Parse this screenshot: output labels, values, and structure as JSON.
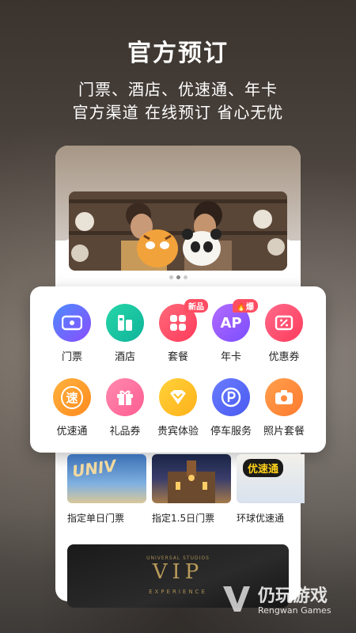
{
  "header": {
    "title": "官方预订",
    "subtitle_line1": "门票、酒店、优速通、年卡",
    "subtitle_line2": "官方渠道 在线预订 省心无忧"
  },
  "menu": {
    "items": [
      {
        "label": "门票",
        "icon": "ticket-icon",
        "color": "#5b6cf0"
      },
      {
        "label": "酒店",
        "icon": "hotel-icon",
        "color": "#19c6a3"
      },
      {
        "label": "套餐",
        "icon": "package-icon",
        "color": "#ff4d6a",
        "badge": "新品"
      },
      {
        "label": "年卡",
        "icon": "annual-pass-icon",
        "color": "#9b5cf6",
        "badge": "爆"
      },
      {
        "label": "优惠券",
        "icon": "coupon-icon",
        "color": "#ff4d6a"
      },
      {
        "label": "优速通",
        "icon": "express-icon",
        "color": "#ff9a2e"
      },
      {
        "label": "礼品券",
        "icon": "gift-icon",
        "color": "#ff6fa0"
      },
      {
        "label": "贵宾体验",
        "icon": "vip-icon",
        "color": "#ffbe1a"
      },
      {
        "label": "停车服务",
        "icon": "parking-icon",
        "color": "#5b6cf0"
      },
      {
        "label": "照片套餐",
        "icon": "camera-icon",
        "color": "#ff8a3d"
      }
    ]
  },
  "cards": [
    {
      "label": "指定单日门票",
      "img_text": "UNIV"
    },
    {
      "label": "指定1.5日门票"
    },
    {
      "label": "环球优速通",
      "img_text": "优速通"
    }
  ],
  "vip_banner": {
    "text": "VIP",
    "sub": "EXPERIENCE",
    "small": "UNIVERSAL STUDIOS"
  },
  "watermark": {
    "title": "仍玩游戏",
    "sub": "Rengwan Games"
  }
}
